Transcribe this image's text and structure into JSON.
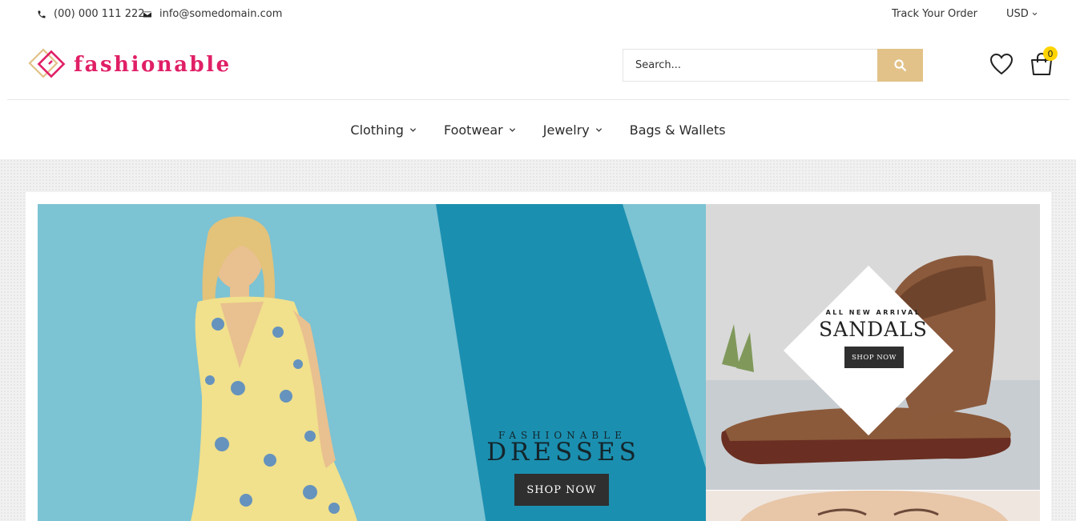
{
  "topbar": {
    "phone": "(00) 000 111 222",
    "email": "info@somedomain.com",
    "track_order": "Track Your Order",
    "currency": "USD"
  },
  "header": {
    "logo_text": "fashionable",
    "search_placeholder": "Search...",
    "cart_count": "0"
  },
  "nav": {
    "items": [
      {
        "label": "Clothing",
        "has_dropdown": true
      },
      {
        "label": "Footwear",
        "has_dropdown": true
      },
      {
        "label": "Jewelry",
        "has_dropdown": true
      },
      {
        "label": "Bags & Wallets",
        "has_dropdown": false
      }
    ]
  },
  "hero": {
    "subtitle": "FASHIONABLE",
    "title": "DRESSES",
    "button": "SHOP NOW"
  },
  "sandals_banner": {
    "subtitle": "ALL NEW ARRIVAL",
    "title": "SANDALS",
    "button": "SHOP NOW"
  },
  "colors": {
    "brand_pink": "#e01f66",
    "brand_gold": "#e2c288",
    "hero_teal": "#7cc3d3",
    "hero_stripe": "#1b8fb0",
    "badge_yellow": "#ffd400"
  },
  "icons": [
    "phone-icon",
    "envelope-icon",
    "chevron-down-icon",
    "search-icon",
    "heart-icon",
    "shopping-bag-icon"
  ]
}
